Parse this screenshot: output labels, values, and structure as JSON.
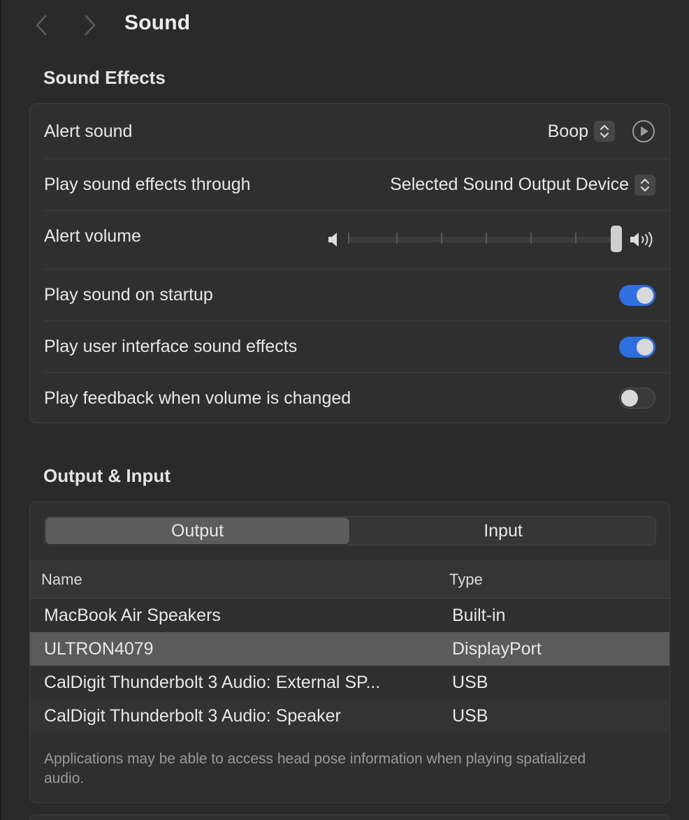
{
  "header": {
    "title": "Sound",
    "back_icon": "chevron-left-icon",
    "forward_icon": "chevron-right-icon"
  },
  "sound_effects": {
    "section_title": "Sound Effects",
    "alert_sound": {
      "label": "Alert sound",
      "value": "Boop"
    },
    "play_through": {
      "label": "Play sound effects through",
      "value": "Selected Sound Output Device"
    },
    "alert_volume": {
      "label": "Alert volume",
      "level": 1.0
    },
    "startup": {
      "label": "Play sound on startup",
      "on": true
    },
    "ui_effects": {
      "label": "Play user interface sound effects",
      "on": true
    },
    "feedback": {
      "label": "Play feedback when volume is changed",
      "on": false
    }
  },
  "output_input": {
    "section_title": "Output & Input",
    "tabs": [
      {
        "label": "Output",
        "active": true
      },
      {
        "label": "Input",
        "active": false
      }
    ],
    "columns": {
      "name": "Name",
      "type": "Type"
    },
    "devices": [
      {
        "name": "MacBook Air Speakers",
        "type": "Built-in",
        "selected": false
      },
      {
        "name": "ULTRON4079",
        "type": "DisplayPort",
        "selected": true
      },
      {
        "name": "CalDigit Thunderbolt 3 Audio: External SP...",
        "type": "USB",
        "selected": false
      },
      {
        "name": "CalDigit Thunderbolt 3 Audio: Speaker",
        "type": "USB",
        "selected": false
      }
    ],
    "footnote": "Applications may be able to access head pose information when playing spatialized audio."
  },
  "colors": {
    "accent": "#2f6fe0",
    "background": "#2a2a2a",
    "card": "#2f2f2f",
    "selected_row": "#5b5b5b"
  }
}
